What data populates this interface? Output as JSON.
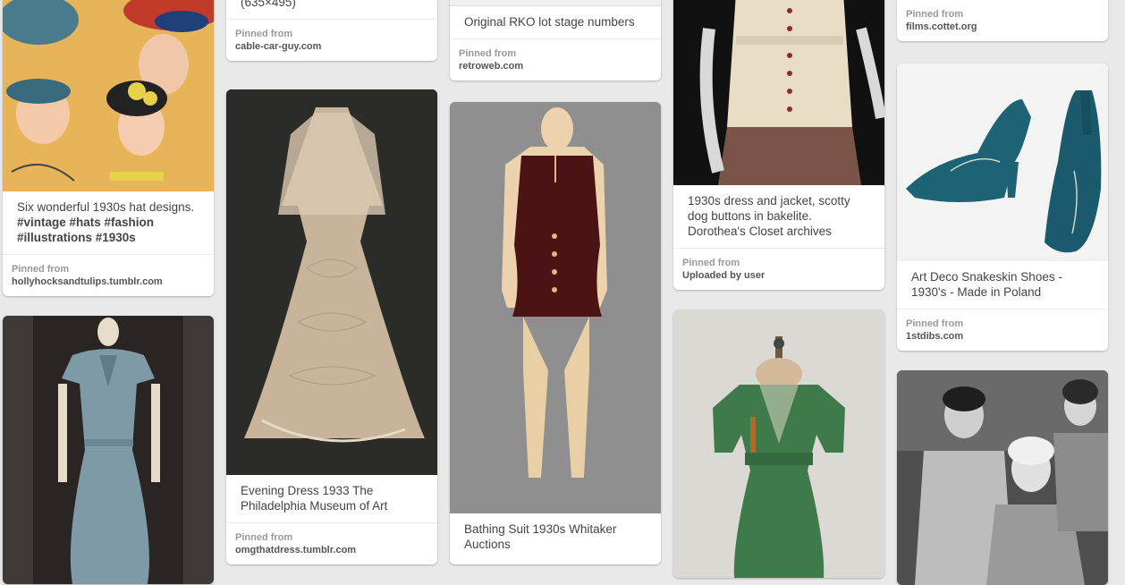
{
  "pins": {
    "hats": {
      "description": "Six wonderful 1930s hat designs.",
      "tags": "#vintage #hats #fashion #illustrations #1930s",
      "source_label": "Pinned from",
      "source": "hollyhocksandtulips.tumblr.com"
    },
    "car_guy": {
      "description": "(635×495)",
      "source_label": "Pinned from",
      "source": "cable-car-guy.com"
    },
    "evening_dress": {
      "description": "Evening Dress 1933 The Philadelphia Museum of Art",
      "source_label": "Pinned from",
      "source": "omgthatdress.tumblr.com"
    },
    "rko": {
      "description": "Original RKO lot stage numbers",
      "source_label": "Pinned from",
      "source": "retroweb.com"
    },
    "bathing_suit": {
      "description": "Bathing Suit 1930s Whitaker Auctions"
    },
    "scotty_dress": {
      "description": "1930s dress and jacket, scotty dog buttons in bakelite. Dorothea's Closet archives",
      "source_label": "Pinned from",
      "source": "Uploaded by user"
    },
    "films": {
      "source_label": "Pinned from",
      "source": "films.cottet.org"
    },
    "shoes": {
      "description": "Art Deco Snakeskin Shoes - 1930's - Made in Poland",
      "source_label": "Pinned from",
      "source": "1stdibs.com"
    }
  },
  "colors": {
    "page_bg": "#e9e9e9",
    "card_bg": "#ffffff",
    "text": "#444444",
    "meta_label": "#999999"
  }
}
